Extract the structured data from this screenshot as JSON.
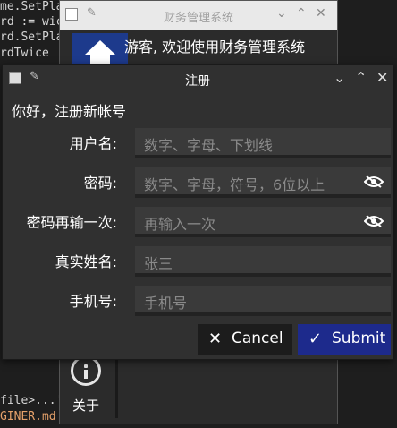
{
  "editor": {
    "lines": [
      "me.SetPla",
      "rd := wic",
      "rd.SetPla",
      "rdTwice",
      "file>...'",
      "GINER.md"
    ]
  },
  "main_window": {
    "title": "财务管理系统",
    "welcome": "游客, 欢迎使用财务管理系统",
    "about_label": "关于",
    "home_icon": "home-icon",
    "about_icon": "info-icon"
  },
  "dialog": {
    "title": "注册",
    "greeting": "你好，注册新帐号",
    "fields": [
      {
        "label": "用户名:",
        "placeholder": "数字、字母、下划线",
        "has_eye": false
      },
      {
        "label": "密码:",
        "placeholder": "数字、字母，符号，6位以上",
        "has_eye": true
      },
      {
        "label": "密码再输一次:",
        "placeholder": "再输入一次",
        "has_eye": true
      },
      {
        "label": "真实姓名:",
        "placeholder": "张三",
        "has_eye": false
      },
      {
        "label": "手机号:",
        "placeholder": "手机号",
        "has_eye": false
      }
    ],
    "cancel_label": "Cancel",
    "submit_label": "Submit"
  },
  "colors": {
    "submit_bg": "#1d2a8c",
    "dialog_bg": "#303030",
    "field_bg": "#3a3a3a"
  }
}
